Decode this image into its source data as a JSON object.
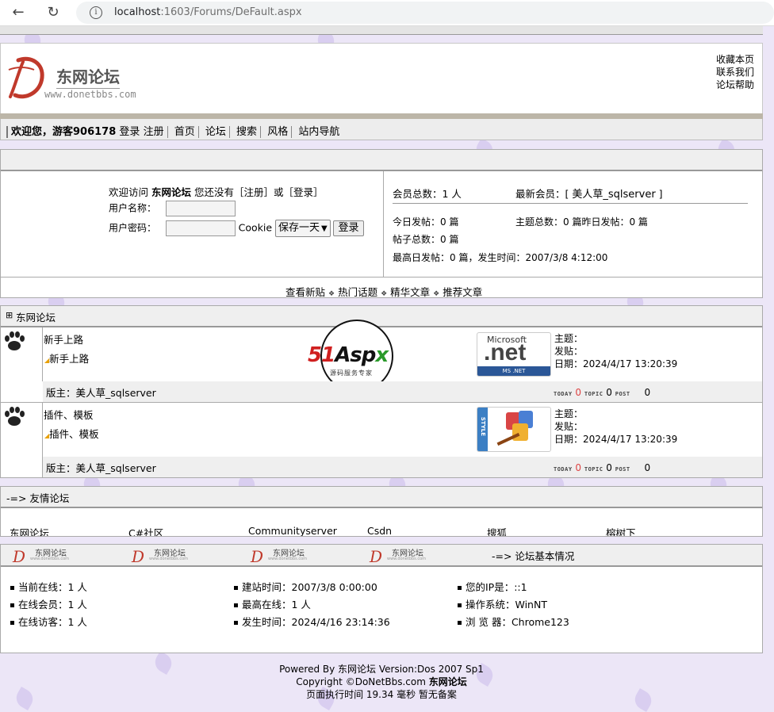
{
  "browser": {
    "url_host": "localhost",
    "url_path": ":1603/Forums/DeFault.aspx"
  },
  "header": {
    "logo_title": "东网论坛",
    "logo_url": "www.donetbbs.com",
    "links": [
      "收藏本页",
      "联系我们",
      "论坛帮助"
    ]
  },
  "nav": {
    "welcome": "欢迎您，游客906178",
    "items": [
      "登录",
      "注册",
      "首页",
      "论坛",
      "搜索",
      "风格",
      "站内导航"
    ]
  },
  "login": {
    "welcome_prefix": "欢迎访问",
    "forum_name": "东网论坛",
    "welcome_suffix": "您还没有［注册］或［登录］",
    "username_label": "用户名称：",
    "password_label": "用户密码：",
    "cookie_label": "Cookie",
    "cookie_option": "保存一天",
    "login_button": "登录"
  },
  "stats": {
    "members": "会员总数：1 人",
    "newest_member_label": "最新会员：[",
    "newest_member": "美人草_sqlserver",
    "newest_member_end": "]",
    "today_posts": "今日发帖：0 篇",
    "topics_total": "主题总数：0 篇",
    "yesterday_posts": "昨日发帖：0 篇",
    "posts_total": "帖子总数：0 篇",
    "max_day": "最高日发帖：0 篇，发生时间：2007/3/8 4:12:00"
  },
  "quicklinks": [
    "查看新贴",
    "热门话题",
    "精华文章",
    "推荐文章"
  ],
  "quick_sep": "❖",
  "category": {
    "expand": "⊞",
    "title": "东网论坛"
  },
  "forums": [
    {
      "name": "新手上路",
      "sub": "新手上路",
      "mod_label": "版主：",
      "moderator": "美人草_sqlserver",
      "topic_label": "主题：",
      "post_label": "发贴：",
      "date_label": "日期：",
      "date": "2024/4/17 13:20:39",
      "today_tag": "TODAY",
      "today": "0",
      "topic_tag": "TOPIC",
      "topic": "0",
      "post_tag": "POST",
      "post": "0",
      "logo_text": "Microsoft .net"
    },
    {
      "name": "插件、模板",
      "sub": "插件、模板",
      "mod_label": "版主：",
      "moderator": "美人草_sqlserver",
      "topic_label": "主题：",
      "post_label": "发贴：",
      "date_label": "日期：",
      "date": "2024/4/17 13:20:39",
      "today_tag": "TODAY",
      "today": "0",
      "topic_tag": "TOPIC",
      "topic": "0",
      "post_tag": "POST",
      "post": "0",
      "logo_text": "STYLE"
    }
  ],
  "watermark": {
    "brand": "51Aspx",
    "sub": "源码服务专家"
  },
  "friends": {
    "title": "-=> 友情论坛",
    "links": [
      "东网论坛",
      "C#社区",
      "Communityserver",
      "Csdn",
      "搜狐",
      "榕树下"
    ]
  },
  "basic": {
    "title": "-=> 论坛基本情况",
    "mini_logo": "东网论坛",
    "mini_url": "www.donetbbs.com",
    "col1": [
      "当前在线：1 人",
      "在线会员：1 人",
      "在线访客：1 人"
    ],
    "col2": [
      "建站时间：2007/3/8 0:00:00",
      "最高在线：1 人",
      "发生时间：2024/4/16 23:14:36"
    ],
    "col3": [
      "您的IP是：::1",
      "操作系统：WinNT",
      "浏 览 器：Chrome123"
    ]
  },
  "footer": {
    "line1": "Powered By 东网论坛 Version:Dos 2007 Sp1",
    "line2_prefix": "Copyright ©DoNetBbs.com",
    "line2_bold": "东网论坛",
    "line3": "页面执行时间 19.34 毫秒  暂无备案"
  },
  "colors": {
    "page_bg": "#ece6f7",
    "leaf": "#cfc2ec",
    "logo_red": "#c0392b",
    "orange": "#dd4444"
  }
}
